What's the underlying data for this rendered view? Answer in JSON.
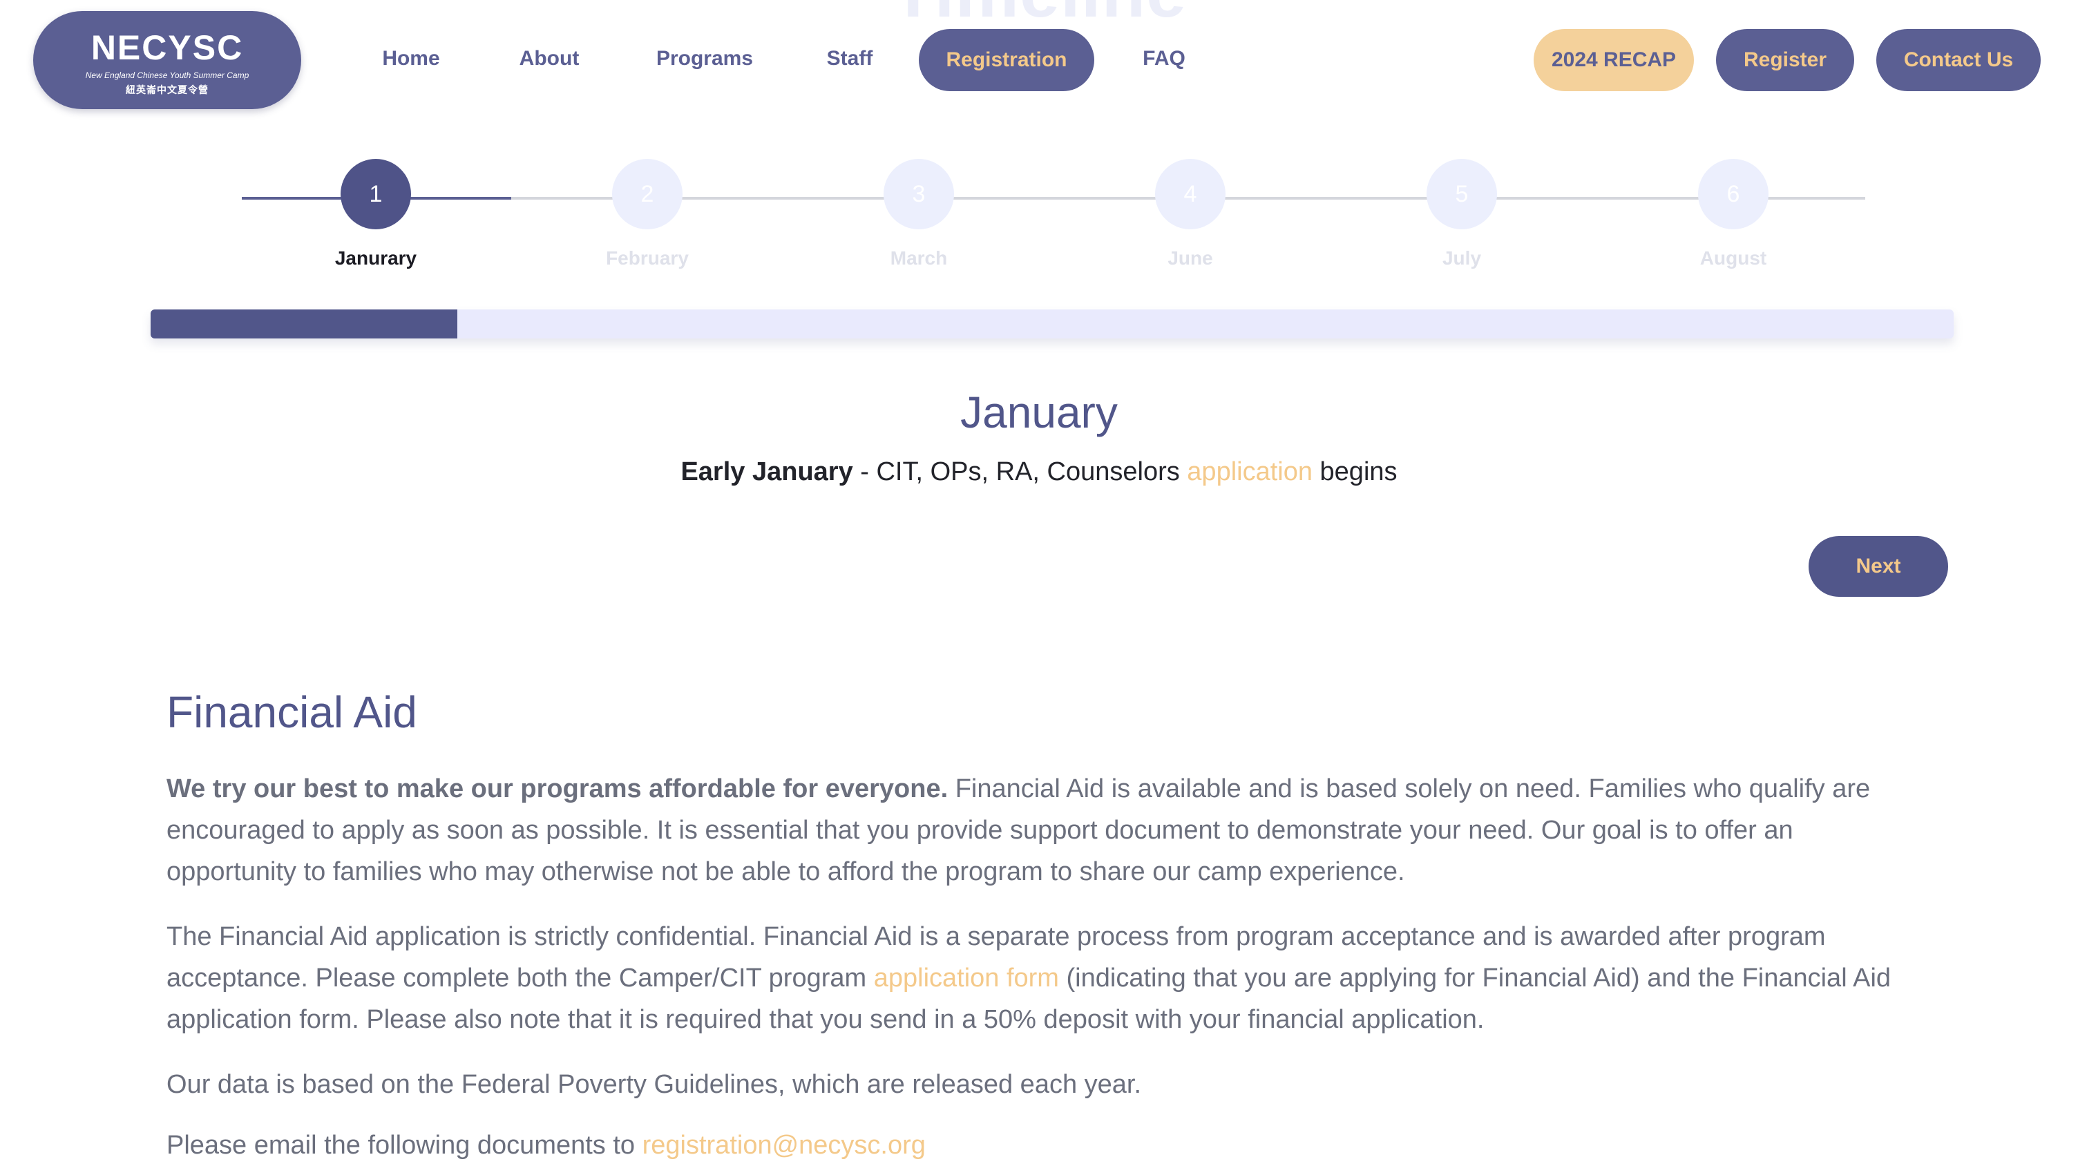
{
  "background_heading": "Timeline",
  "logo": {
    "title": "NECYSC",
    "subtitle": "New England Chinese Youth Summer Camp",
    "subtitle_zh": "紐英崙中文夏令營"
  },
  "nav": {
    "links": [
      "Home",
      "About",
      "Programs",
      "Staff",
      "Registration",
      "FAQ"
    ],
    "active": "Registration",
    "buttons": {
      "recap": "2024 RECAP",
      "register": "Register",
      "contact": "Contact Us"
    }
  },
  "timeline": {
    "steps": [
      {
        "number": "1",
        "label": "Janurary",
        "active": true
      },
      {
        "number": "2",
        "label": "February",
        "active": false
      },
      {
        "number": "3",
        "label": "March",
        "active": false
      },
      {
        "number": "4",
        "label": "June",
        "active": false
      },
      {
        "number": "5",
        "label": "July",
        "active": false
      },
      {
        "number": "6",
        "label": "August",
        "active": false
      }
    ],
    "progress_fraction": 0.17,
    "current": {
      "title": "January",
      "bold": "Early January",
      "text_before": " - CIT, OPs, RA, Counselors ",
      "link": "application",
      "text_after": " begins"
    },
    "next_label": "Next"
  },
  "financial_aid": {
    "title": "Financial Aid",
    "p1_bold": "We try our best to make our programs affordable for everyone.",
    "p1_rest": " Financial Aid is available and is based solely on need. Families who qualify are encouraged to apply as soon as possible. It is essential that you provide support document to demonstrate your need. Our goal is to offer an opportunity to families who may otherwise not be able to afford the program to share our camp experience.",
    "p2_before": "The Financial Aid application is strictly confidential. Financial Aid is a separate process from program acceptance and is awarded after program acceptance. Please complete both the Camper/CIT program ",
    "p2_link": "application form",
    "p2_after": " (indicating that you are applying for Financial Aid) and the Financial Aid application form. Please also note that it is required that you send in a 50% deposit with your financial application.",
    "p3": "Our data is based on the Federal Poverty Guidelines, which are released each year.",
    "p4_before": "Please email the following documents to ",
    "p4_link": "registration@necysc.org"
  },
  "colors": {
    "primary": "#51568a",
    "accent": "#f4c98a",
    "recap_bg": "#f4d19b",
    "inactive_step": "#eceffd",
    "text": "#6b6f7d"
  }
}
